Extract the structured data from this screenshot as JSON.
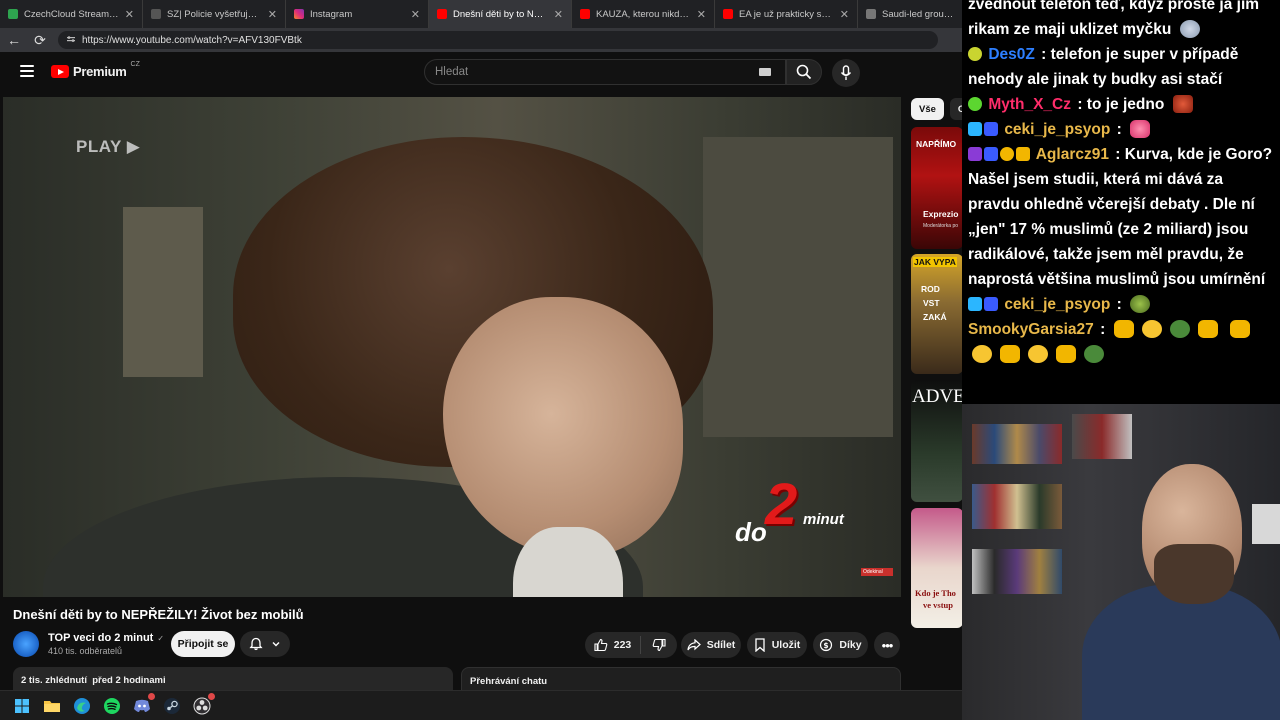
{
  "browser": {
    "tabs": [
      {
        "title": "CzechCloud Stream - Watch",
        "favicon_color": "#2ea44f"
      },
      {
        "title": "SZ| Policie vyšetřuje Turkovu ne",
        "favicon_color": "#555555"
      },
      {
        "title": "Instagram",
        "favicon_color": "#e1306c"
      },
      {
        "title": "Dnešní děti by to NEPŘEŽILY",
        "favicon_color": "#ff0000",
        "active": true
      },
      {
        "title": "KAUZA, kterou nikdo NECHA",
        "favicon_color": "#ff0000"
      },
      {
        "title": "EA je už prakticky saúdská. E",
        "favicon_color": "#ff0000"
      },
      {
        "title": "Saudi-led group complet",
        "favicon_color": "#777777"
      }
    ],
    "url": "https://www.youtube.com/watch?v=AFV130FVBtk"
  },
  "youtube": {
    "logo_text": "Premium",
    "logo_country": "CZ",
    "search_placeholder": "Hledat",
    "video": {
      "overlay_play": "PLAY ▶",
      "brand_do": "do",
      "brand_two": "2",
      "brand_minut": "minut",
      "corner_tag": "Odekinal",
      "title": "Dnešní děti by to NEPŘEŽILY! Život bez mobilů"
    },
    "channel": {
      "name": "TOP veci do 2 minut",
      "verified": "✓",
      "subscribers": "410 tis. odběratelů"
    },
    "buttons": {
      "join": "Připojit se",
      "like_count": "223",
      "share": "Sdílet",
      "save": "Uložit",
      "thanks": "Díky",
      "more": "•••"
    },
    "description": {
      "views_time": "2 tis. zhlédnutí  před 2 hodinami"
    },
    "chat_replay": "Přehrávání chatu",
    "chips": [
      "Vše",
      "O"
    ],
    "recommendations": [
      {
        "label1": "NAPŘÍMO",
        "label2": "Exprezio",
        "label3": "Moderátorka po"
      },
      {
        "label1": "JAK VYPA",
        "label2": "ROD",
        "label3": "VST",
        "label4": "ZAKÁ"
      },
      {
        "label1": "ADVE"
      },
      {
        "label1": "Kdo je Tho",
        "label2": "ve vstup"
      }
    ]
  },
  "stream_chat": {
    "messages": [
      {
        "user": "",
        "text": "zvednout telefon teď, když prostě já jim"
      },
      {
        "user": "",
        "text": "rikam ze maji uklizet myčku"
      },
      {
        "user": "Des0Z",
        "user_color": "#2d7fff",
        "text": ": telefon je super v případě nehody ale jinak ty budky asi stačí"
      },
      {
        "user": "Myth_X_Cz",
        "user_color": "#ff2d6a",
        "text": ": to je jedno"
      },
      {
        "user": "ceki_je_psyop",
        "user_color": "#e8b84a",
        "text": ":"
      },
      {
        "user": "Aglarcz91",
        "user_color": "#e8b84a",
        "text": ": Kurva, kde je Goro? Našel jsem studii, která mi dává za pravdu ohledně včerejší debaty  . Dle ní „jen\" 17 % muslimů (ze 2 miliard) jsou radikálové, takže jsem měl pravdu, že naprostá většina muslimů jsou umírnění"
      },
      {
        "user": "ceki_je_psyop",
        "user_color": "#e8b84a",
        "text": ":"
      },
      {
        "user": "SmookyGarsia27",
        "user_color": "#e8b84a",
        "text": ":"
      }
    ]
  },
  "taskbar": {
    "icons": [
      "windows-start-icon",
      "file-explorer-icon",
      "edge-icon",
      "spotify-icon",
      "discord-icon",
      "steam-icon",
      "obs-icon"
    ],
    "discord_badge": "9+"
  }
}
